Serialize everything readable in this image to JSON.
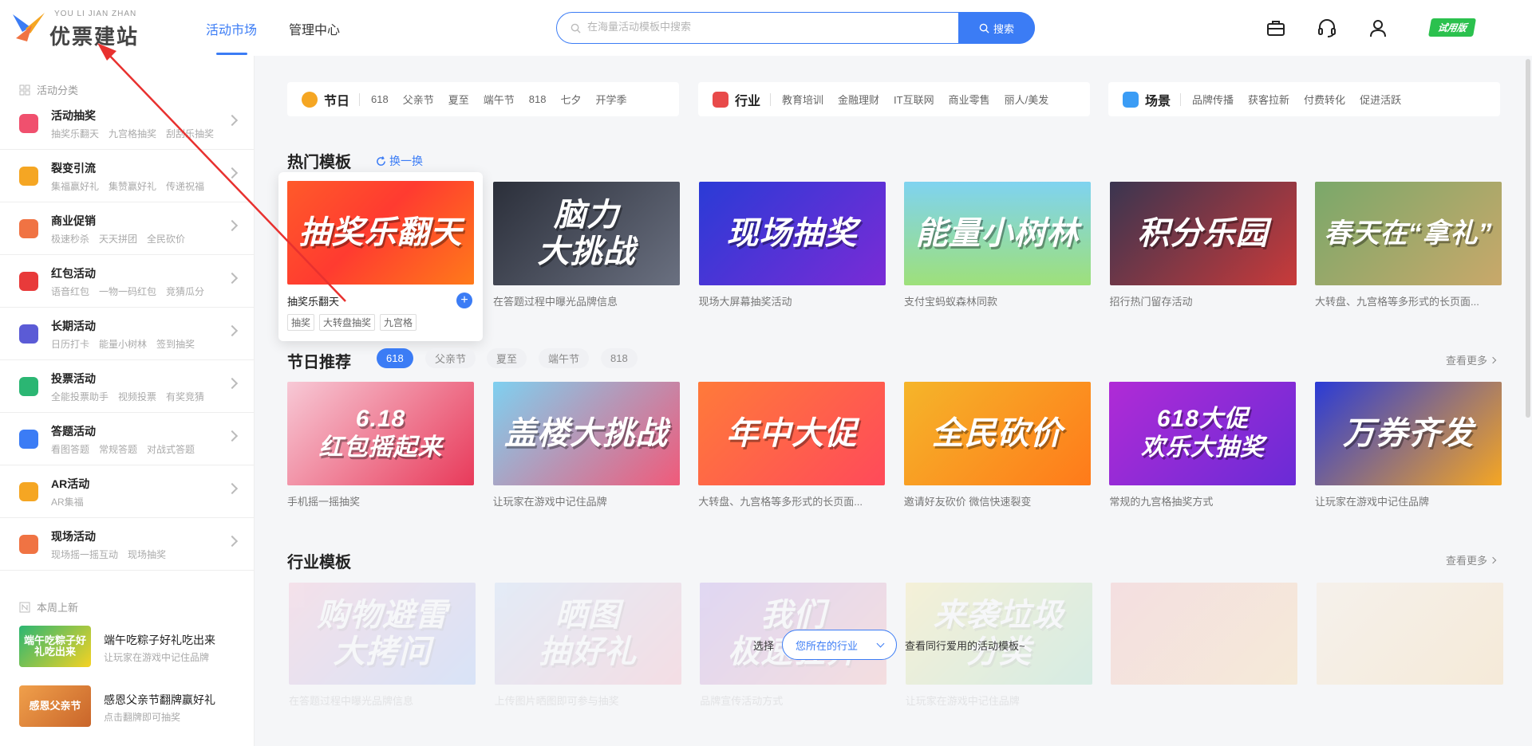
{
  "header": {
    "logo_text": "优票建站",
    "logo_sub": "YOU LI JIAN ZHAN",
    "tabs": [
      {
        "label": "活动市场",
        "active": true
      },
      {
        "label": "管理中心",
        "active": false
      }
    ],
    "search_placeholder": "在海量活动模板中搜索",
    "search_button": "搜索",
    "icons": [
      "briefcase-icon",
      "headset-icon",
      "user-icon"
    ],
    "trial_label": "试用版"
  },
  "sidebar": {
    "section_categories": "活动分类",
    "categories": [
      {
        "title": "活动抽奖",
        "subs": [
          "抽奖乐翻天",
          "九宫格抽奖",
          "刮刮乐抽奖"
        ],
        "icon": "gift-icon",
        "color": "#f0506e"
      },
      {
        "title": "裂变引流",
        "subs": [
          "集福赢好礼",
          "集赞赢好礼",
          "传递祝福"
        ],
        "icon": "users-icon",
        "color": "#f5a623"
      },
      {
        "title": "商业促销",
        "subs": [
          "极速秒杀",
          "天天拼团",
          "全民砍价"
        ],
        "icon": "tag-icon",
        "color": "#f07343"
      },
      {
        "title": "红包活动",
        "subs": [
          "语音红包",
          "一物一码红包",
          "竞猜瓜分"
        ],
        "icon": "redpacket-icon",
        "color": "#e83a3a"
      },
      {
        "title": "长期活动",
        "subs": [
          "日历打卡",
          "能量小树林",
          "签到抽奖"
        ],
        "icon": "calendar-icon",
        "color": "#5b5bd6"
      },
      {
        "title": "投票活动",
        "subs": [
          "全能投票助手",
          "视频投票",
          "有奖竞猜"
        ],
        "icon": "vote-icon",
        "color": "#2bb673"
      },
      {
        "title": "答题活动",
        "subs": [
          "看图答题",
          "常规答题",
          "对战式答题"
        ],
        "icon": "question-icon",
        "color": "#3b7cf5"
      },
      {
        "title": "AR活动",
        "subs": [
          "AR集福"
        ],
        "icon": "ar-icon",
        "color": "#f5a623"
      },
      {
        "title": "现场活动",
        "subs": [
          "现场摇一摇互动",
          "现场抽奖"
        ],
        "icon": "stage-icon",
        "color": "#f07343"
      }
    ],
    "section_new": "本周上新",
    "new_items": [
      {
        "title": "端午吃粽子好礼吃出来",
        "sub": "让玩家在游戏中记住品牌",
        "thumb": "端午吃粽子好礼吃出来"
      },
      {
        "title": "感恩父亲节翻牌赢好礼",
        "sub": "点击翻牌即可抽奖",
        "thumb": "感恩父亲节"
      }
    ]
  },
  "filters": [
    {
      "title": "节日",
      "icon": "balloon-icon",
      "color": "#f5a623",
      "tags": [
        "618",
        "父亲节",
        "夏至",
        "端午节",
        "818",
        "七夕",
        "开学季"
      ]
    },
    {
      "title": "行业",
      "icon": "building-icon",
      "color": "#e84a4a",
      "tags": [
        "教育培训",
        "金融理财",
        "IT互联网",
        "商业零售",
        "丽人/美发"
      ]
    },
    {
      "title": "场景",
      "icon": "cube-icon",
      "color": "#3b9cf5",
      "tags": [
        "品牌传播",
        "获客拉新",
        "付费转化",
        "促进活跃"
      ]
    }
  ],
  "hot": {
    "title": "热门模板",
    "refresh_label": "换一换",
    "hover_card": {
      "title": "抽奖乐翻天",
      "tags": [
        "抽奖",
        "大转盘抽奖",
        "九宫格"
      ],
      "thumb": "抽奖乐翻天"
    },
    "cards": [
      {
        "thumb": "脑力\n大挑战",
        "desc": "在答题过程中曝光品牌信息"
      },
      {
        "thumb": "现场抽奖",
        "desc": "现场大屏幕抽奖活动"
      },
      {
        "thumb": "能量小树林",
        "desc": "支付宝蚂蚁森林同款"
      },
      {
        "thumb": "积分乐园",
        "desc": "招行热门留存活动"
      },
      {
        "thumb": "春天在“拿礼”",
        "desc": "大转盘、九宫格等多形式的长页面..."
      }
    ]
  },
  "festival": {
    "title": "节日推荐",
    "more_label": "查看更多",
    "pills": [
      {
        "label": "618",
        "active": true
      },
      {
        "label": "父亲节",
        "active": false
      },
      {
        "label": "夏至",
        "active": false
      },
      {
        "label": "端午节",
        "active": false
      },
      {
        "label": "818",
        "active": false
      }
    ],
    "cards": [
      {
        "thumb": "6.18\n红包摇起来",
        "desc": "手机摇一摇抽奖"
      },
      {
        "thumb": "盖楼大挑战",
        "desc": "让玩家在游戏中记住品牌"
      },
      {
        "thumb": "年中大促",
        "desc": "大转盘、九宫格等多形式的长页面..."
      },
      {
        "thumb": "全民砍价",
        "desc": "邀请好友砍价 微信快速裂变"
      },
      {
        "thumb": "618大促\n欢乐大抽奖",
        "desc": "常规的九宫格抽奖方式"
      },
      {
        "thumb": "万券齐发",
        "desc": "让玩家在游戏中记住品牌"
      }
    ]
  },
  "industry": {
    "title": "行业模板",
    "more_label": "查看更多",
    "select_prefix": "选择",
    "select_value": "您所在的行业",
    "select_suffix": "查看同行爱用的活动模板~",
    "cards": [
      {
        "thumb": "购物避雷\n大拷问",
        "desc": "在答题过程中曝光品牌信息"
      },
      {
        "thumb": "晒图\n抽好礼",
        "desc": "上传图片晒图即可参与抽奖"
      },
      {
        "thumb": "我们\n极速狂奔",
        "desc": "品牌宣传活动方式"
      },
      {
        "thumb": "来袭垃圾\n分类",
        "desc": "让玩家在游戏中记住品牌"
      },
      {
        "thumb": "",
        "desc": ""
      },
      {
        "thumb": "",
        "desc": ""
      }
    ]
  },
  "colors": {
    "accent": "#3b7cf5",
    "trial": "#2bc14e",
    "annotation_arrow": "#e8312f"
  }
}
